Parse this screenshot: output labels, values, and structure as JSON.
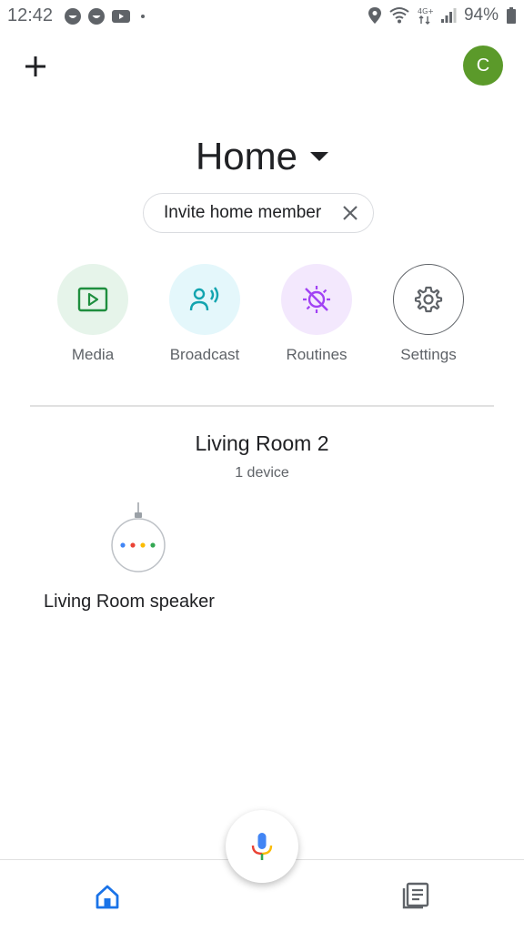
{
  "status_bar": {
    "time": "12:42",
    "battery": "94%",
    "left_icons": [
      "notification-face-icon",
      "notification-face-icon",
      "youtube-icon",
      "dot-icon"
    ],
    "right_icons": [
      "location-icon",
      "wifi-icon",
      "network-4g-icon",
      "signal-icon",
      "battery-icon"
    ]
  },
  "header": {
    "add_icon": "plus-icon",
    "avatar_letter": "C",
    "avatar_color": "#5b9a2a"
  },
  "home": {
    "title": "Home",
    "invite_label": "Invite home member"
  },
  "actions": [
    {
      "label": "Media",
      "icon": "play-icon",
      "bg": "#e6f4ea",
      "fg": "#1e8e3e"
    },
    {
      "label": "Broadcast",
      "icon": "broadcast-icon",
      "bg": "#e4f7fb",
      "fg": "#12a4af"
    },
    {
      "label": "Routines",
      "icon": "routines-icon",
      "bg": "#f3e8fd",
      "fg": "#a142f4"
    },
    {
      "label": "Settings",
      "icon": "gear-icon",
      "bg": "#ffffff",
      "fg": "#5f6368"
    }
  ],
  "room": {
    "name": "Living Room 2",
    "device_count": "1 device"
  },
  "devices": [
    {
      "name": "Living Room speaker",
      "icon": "speaker-icon"
    }
  ],
  "bottom_nav": {
    "items": [
      "home-icon",
      "feed-icon"
    ],
    "mic_icon": "mic-icon"
  }
}
